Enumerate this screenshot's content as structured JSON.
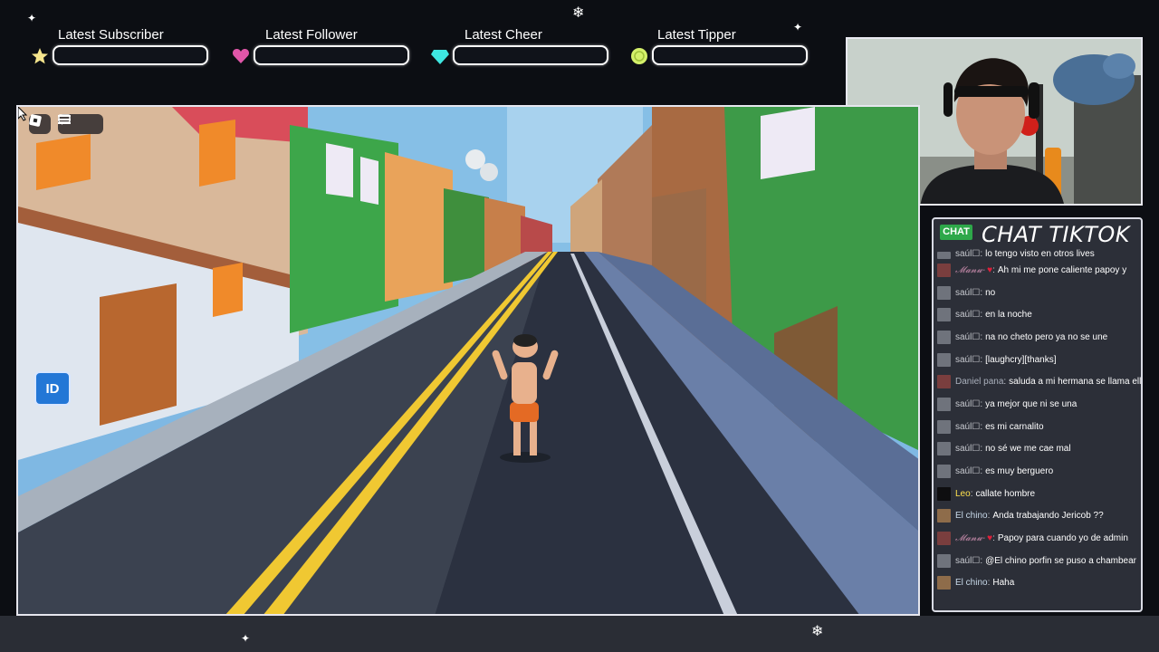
{
  "overlay": {
    "alerts": [
      {
        "label": "Latest Subscriber",
        "icon": "star-icon",
        "color": "#f6e58d"
      },
      {
        "label": "Latest Follower",
        "icon": "heart-icon",
        "color": "#e056a8"
      },
      {
        "label": "Latest Cheer",
        "icon": "diamond-icon",
        "color": "#3ee6e0"
      },
      {
        "label": "Latest Tipper",
        "icon": "coin-icon",
        "color": "#d4f06a"
      }
    ]
  },
  "game": {
    "id_button_label": "ID",
    "roblox_menu_icons": [
      "roblox-logo-icon",
      "hamburger-menu-icon",
      "chat-bubble-icon"
    ]
  },
  "chat": {
    "badge": "CHAT",
    "title": "CHAT TIKTOK",
    "messages": [
      {
        "user": "saúl☐",
        "text": "lo tengo visto en otros lives",
        "avatar": "grey"
      },
      {
        "user": "𝓜𝓪𝓷𝓾-",
        "heart": "♥",
        "text": "Ah mi me pone caliente papoy y",
        "avatar": "red"
      },
      {
        "user": "saúl☐",
        "text": "no",
        "avatar": "grey"
      },
      {
        "user": "saúl☐",
        "text": "en la noche",
        "avatar": "grey"
      },
      {
        "user": "saúl☐",
        "text": "na no cheto pero ya no se une",
        "avatar": "grey"
      },
      {
        "user": "saúl☐",
        "text": "[laughcry][thanks]",
        "avatar": "grey"
      },
      {
        "user": "Daniel pana",
        "text": "saluda a mi hermana se llama ell",
        "avatar": "red"
      },
      {
        "user": "saúl☐",
        "text": "ya mejor que ni se una",
        "avatar": "grey"
      },
      {
        "user": "saúl☐",
        "text": "es mi carnalito",
        "avatar": "grey"
      },
      {
        "user": "saúl☐",
        "text": "no sé we me cae mal",
        "avatar": "grey"
      },
      {
        "user": "saúl☐",
        "text": "es muy berguero",
        "avatar": "grey"
      },
      {
        "user": "Leo",
        "text": "callate hombre",
        "avatar": "dark"
      },
      {
        "user": "El chino",
        "text": "Anda trabajando Jericob ??",
        "avatar": "brown"
      },
      {
        "user": "𝓜𝓪𝓷𝓾-",
        "heart": "♥",
        "text": "Papoy para cuando yo de admin",
        "avatar": "red"
      },
      {
        "user": "saúl☐",
        "text": "@El chino porfin se puso a chambear",
        "avatar": "grey"
      },
      {
        "user": "El chino",
        "text": "Haha",
        "avatar": "brown"
      }
    ]
  }
}
